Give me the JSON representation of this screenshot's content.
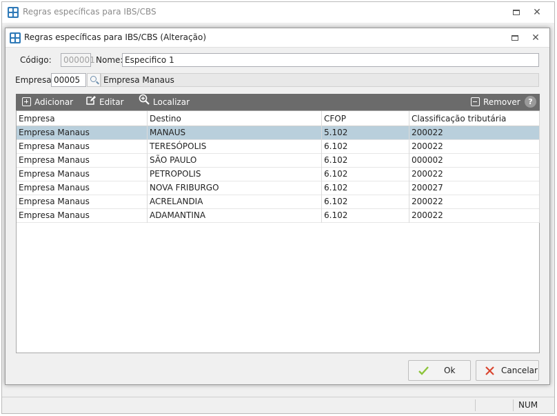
{
  "outer_window": {
    "title": "Regras específicas para IBS/CBS",
    "status": {
      "num": "NUM"
    }
  },
  "dialog": {
    "title": "Regras específicas para IBS/CBS (Alteração)",
    "codigo_label": "Código:",
    "codigo_value": "000001",
    "nome_label": "Nome:",
    "nome_value": "Especifico 1",
    "empresa_label": "Empresa:",
    "empresa_code": "00005",
    "empresa_name": "Empresa Manaus"
  },
  "toolbar": {
    "add_label": "Adicionar",
    "edit_label": "Editar",
    "find_label": "Localizar",
    "remove_label": "Remover",
    "help_label": "?"
  },
  "grid": {
    "columns": [
      "Empresa",
      "Destino",
      "CFOP",
      "Classificação tributária"
    ],
    "rows": [
      [
        "Empresa Manaus",
        "MANAUS",
        "5.102",
        "200022"
      ],
      [
        "Empresa Manaus",
        "TERESÓPOLIS",
        "6.102",
        "200022"
      ],
      [
        "Empresa Manaus",
        "SÃO PAULO",
        "6.102",
        "000002"
      ],
      [
        "Empresa Manaus",
        "PETROPOLIS",
        "6.102",
        "200022"
      ],
      [
        "Empresa Manaus",
        "NOVA FRIBURGO",
        "6.102",
        "200027"
      ],
      [
        "Empresa Manaus",
        "ACRELANDIA",
        "6.102",
        "200022"
      ],
      [
        "Empresa Manaus",
        "ADAMANTINA",
        "6.102",
        "200022"
      ]
    ],
    "selected_row": 0
  },
  "buttons": {
    "ok_label": "Ok",
    "cancel_label": "Cancelar"
  },
  "colors": {
    "toolbar_bg": "#6b6b6b",
    "selected_row": "#b9cfdc",
    "ok_check": "#8cc43a",
    "cancel_x": "#d9452f",
    "app_icon": "#2f7ab8"
  }
}
